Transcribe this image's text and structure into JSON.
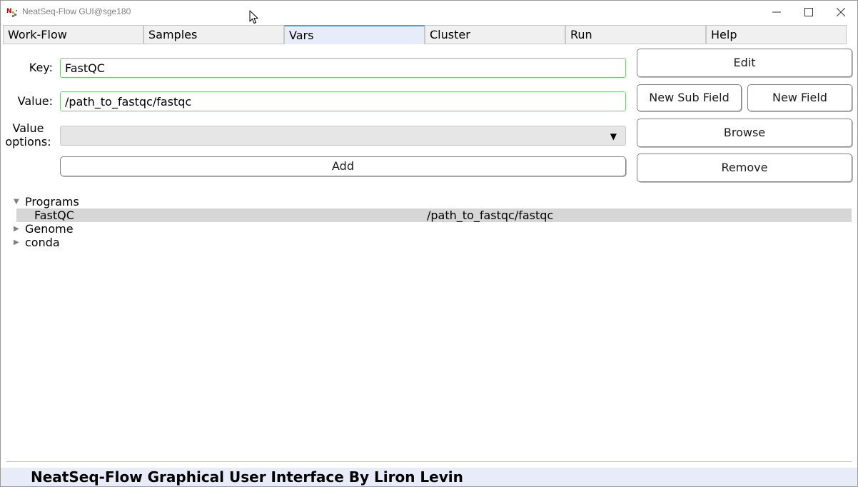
{
  "window": {
    "title": "NeatSeq-Flow GUI@sge180"
  },
  "tabs": [
    {
      "label": "Work-Flow",
      "active": false
    },
    {
      "label": "Samples",
      "active": false
    },
    {
      "label": "Vars",
      "active": true
    },
    {
      "label": "Cluster",
      "active": false
    },
    {
      "label": "Run",
      "active": false
    },
    {
      "label": "Help",
      "active": false
    }
  ],
  "form": {
    "key_label": "Key:",
    "key_value": "FastQC",
    "value_label": "Value:",
    "value_value": "/path_to_fastqc/fastqc",
    "options_label_line1": "Value",
    "options_label_line2": "options:",
    "options_selected": "",
    "options_arrow": "▼",
    "add_label": "Add"
  },
  "buttons": {
    "edit": "Edit",
    "new_sub_field": "New Sub Field",
    "new_field": "New Field",
    "browse": "Browse",
    "remove": "Remove"
  },
  "tree": {
    "expanded_glyph": "▼",
    "collapsed_glyph": "▶",
    "items": [
      {
        "label": "Programs",
        "expanded": true,
        "children": [
          {
            "label": "FastQC",
            "value": "/path_to_fastqc/fastqc",
            "selected": true
          }
        ]
      },
      {
        "label": "Genome",
        "expanded": false
      },
      {
        "label": "conda",
        "expanded": false
      }
    ]
  },
  "status": {
    "text": "NeatSeq-Flow Graphical User Interface By Liron Levin"
  },
  "colors": {
    "active_tab": "#e8ecf8",
    "active_tab_accent": "#5b9bd5",
    "field_focus_border": "#7cc47c",
    "selected_row": "#d6d6d6"
  }
}
